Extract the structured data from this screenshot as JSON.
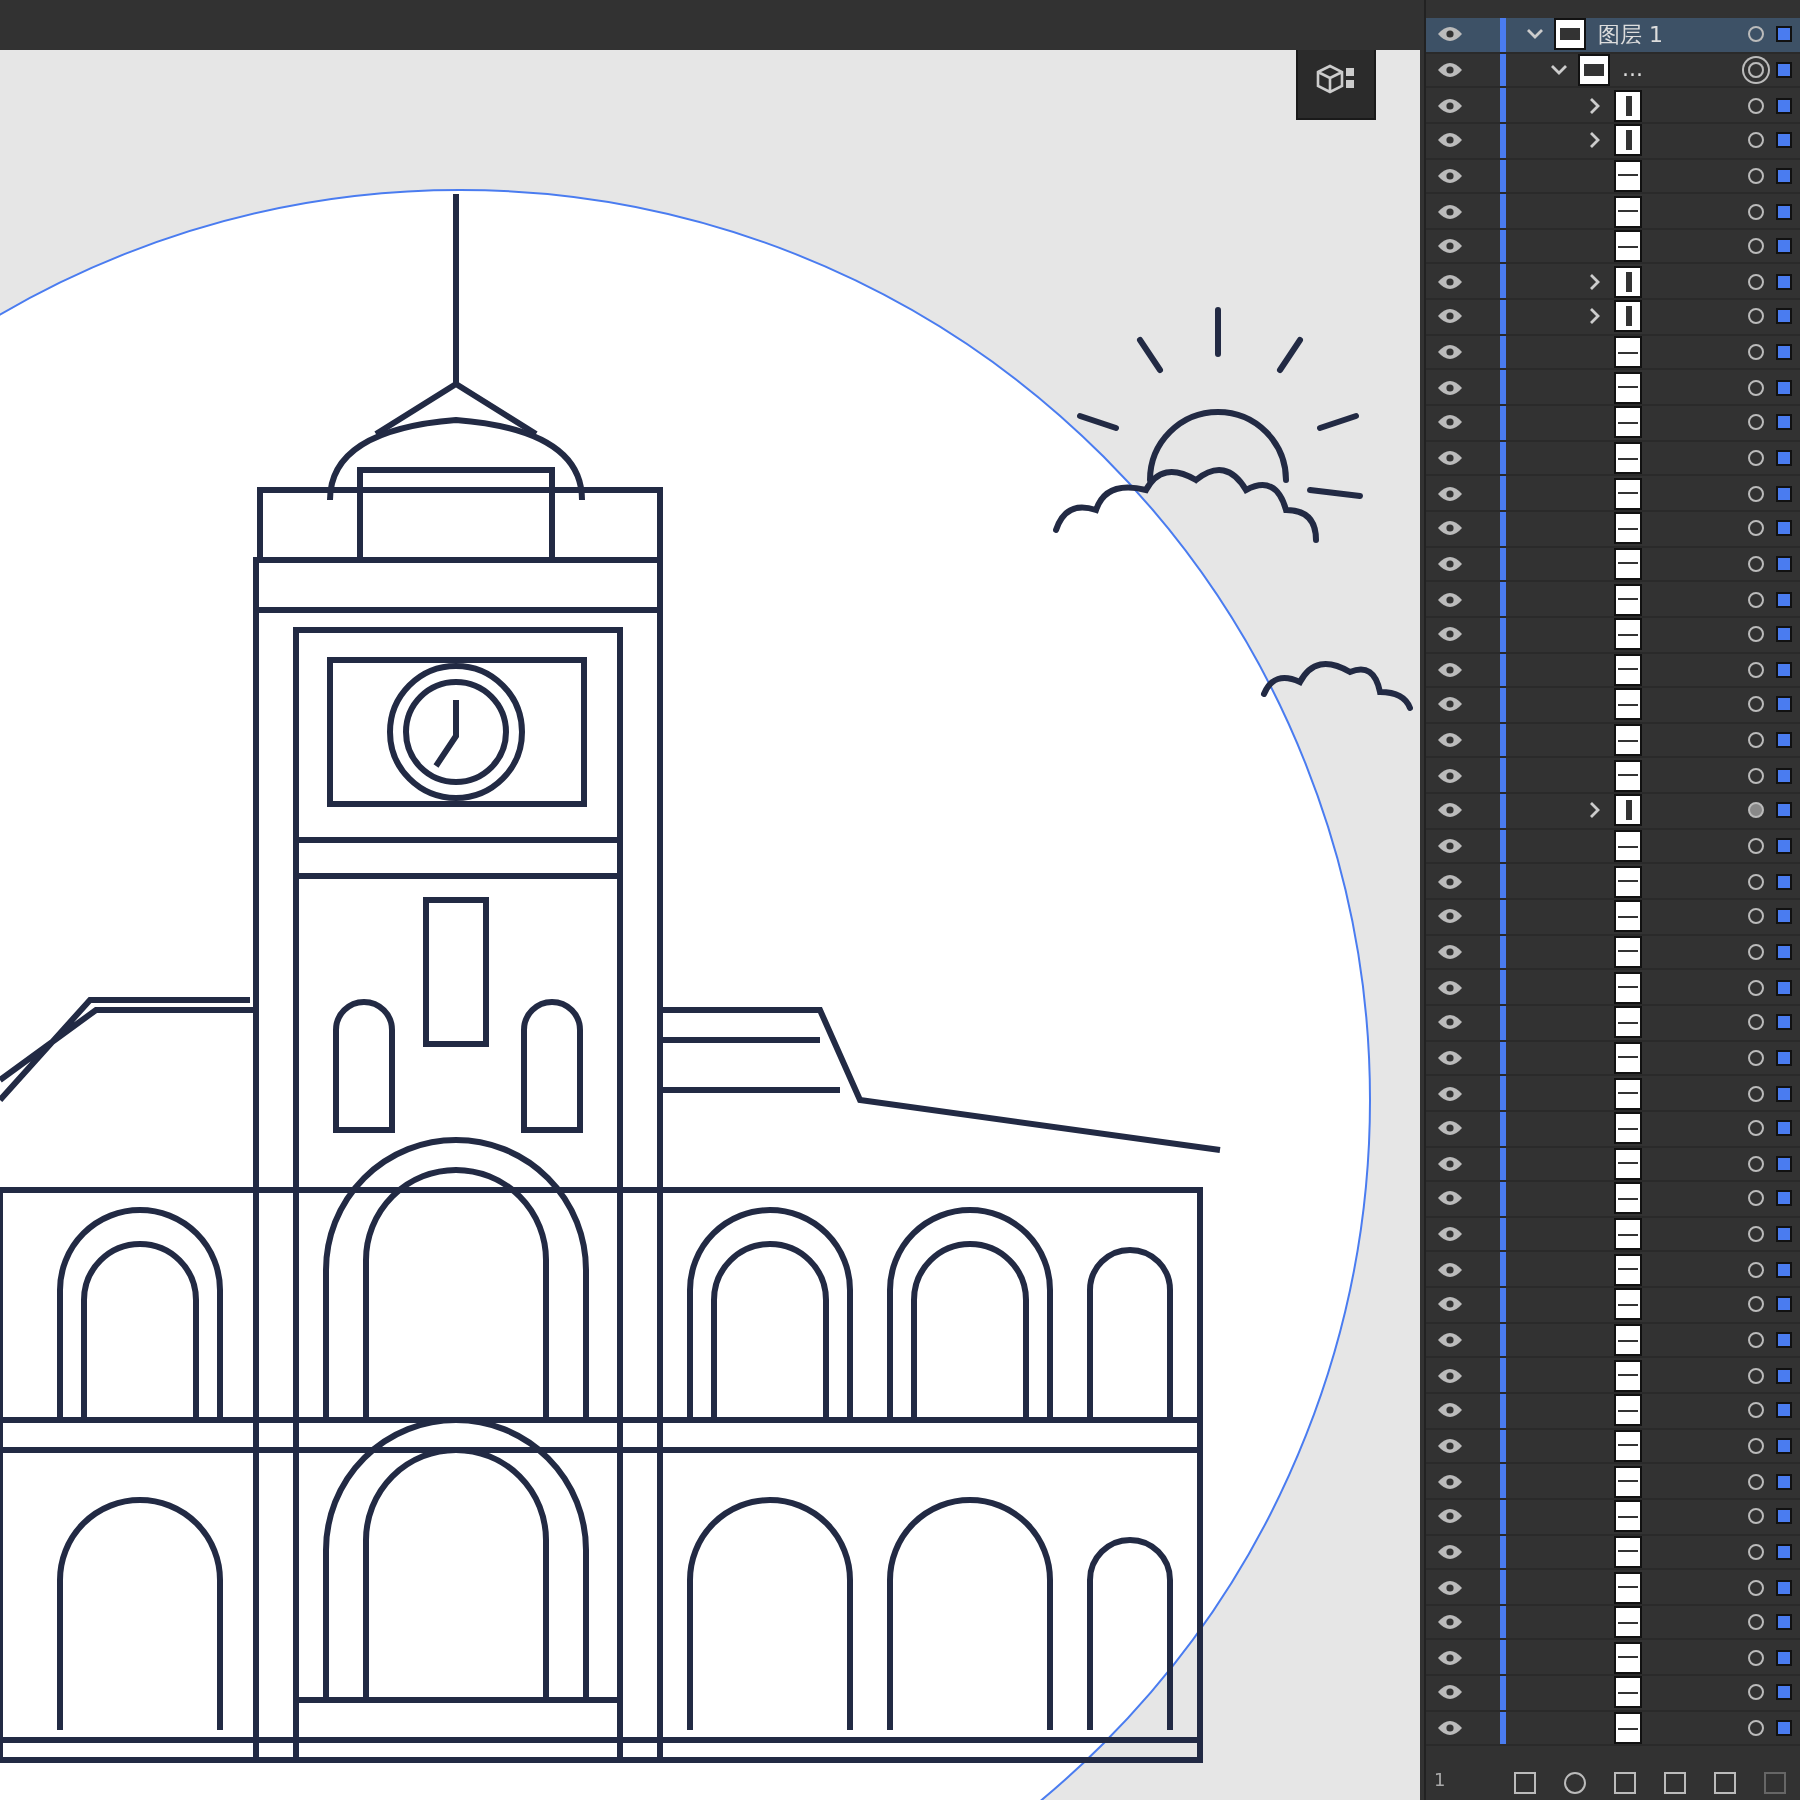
{
  "layers_panel": {
    "layers": [
      {
        "name": "图层 1",
        "expanded": true,
        "selected": true,
        "children": [
          {
            "name": "...",
            "expanded": true,
            "selected": false,
            "children": [
              {
                "kind": "group",
                "targeted": false
              },
              {
                "kind": "group",
                "targeted": false
              },
              {
                "kind": "path",
                "targeted": false
              },
              {
                "kind": "path",
                "targeted": false
              },
              {
                "kind": "path",
                "targeted": false
              },
              {
                "kind": "group",
                "targeted": false
              },
              {
                "kind": "group",
                "targeted": false
              },
              {
                "kind": "path",
                "targeted": false
              },
              {
                "kind": "path",
                "targeted": false
              },
              {
                "kind": "path",
                "targeted": false
              },
              {
                "kind": "path",
                "targeted": false
              },
              {
                "kind": "path",
                "targeted": false
              },
              {
                "kind": "path",
                "targeted": false
              },
              {
                "kind": "path",
                "targeted": false
              },
              {
                "kind": "path",
                "targeted": false
              },
              {
                "kind": "path",
                "targeted": false
              },
              {
                "kind": "path",
                "targeted": false
              },
              {
                "kind": "path",
                "targeted": false
              },
              {
                "kind": "path",
                "targeted": false
              },
              {
                "kind": "path",
                "targeted": false
              },
              {
                "kind": "group",
                "targeted": true
              },
              {
                "kind": "path",
                "targeted": false
              },
              {
                "kind": "path",
                "targeted": false
              },
              {
                "kind": "path",
                "targeted": false
              },
              {
                "kind": "path",
                "targeted": false
              },
              {
                "kind": "path",
                "targeted": false
              },
              {
                "kind": "path",
                "targeted": false
              },
              {
                "kind": "path",
                "targeted": false
              },
              {
                "kind": "path",
                "targeted": false
              },
              {
                "kind": "path",
                "targeted": false
              },
              {
                "kind": "path",
                "targeted": false
              },
              {
                "kind": "path",
                "targeted": false
              },
              {
                "kind": "path",
                "targeted": false
              },
              {
                "kind": "path",
                "targeted": false
              },
              {
                "kind": "path",
                "targeted": false
              },
              {
                "kind": "path",
                "targeted": false
              },
              {
                "kind": "path",
                "targeted": false
              },
              {
                "kind": "path",
                "targeted": false
              },
              {
                "kind": "path",
                "targeted": false
              },
              {
                "kind": "path",
                "targeted": false
              },
              {
                "kind": "path",
                "targeted": false
              },
              {
                "kind": "path",
                "targeted": false
              },
              {
                "kind": "path",
                "targeted": false
              },
              {
                "kind": "path",
                "targeted": false
              },
              {
                "kind": "path",
                "targeted": false
              },
              {
                "kind": "path",
                "targeted": false
              },
              {
                "kind": "path",
                "targeted": false
              }
            ]
          }
        ]
      }
    ],
    "layer_count": "1"
  }
}
